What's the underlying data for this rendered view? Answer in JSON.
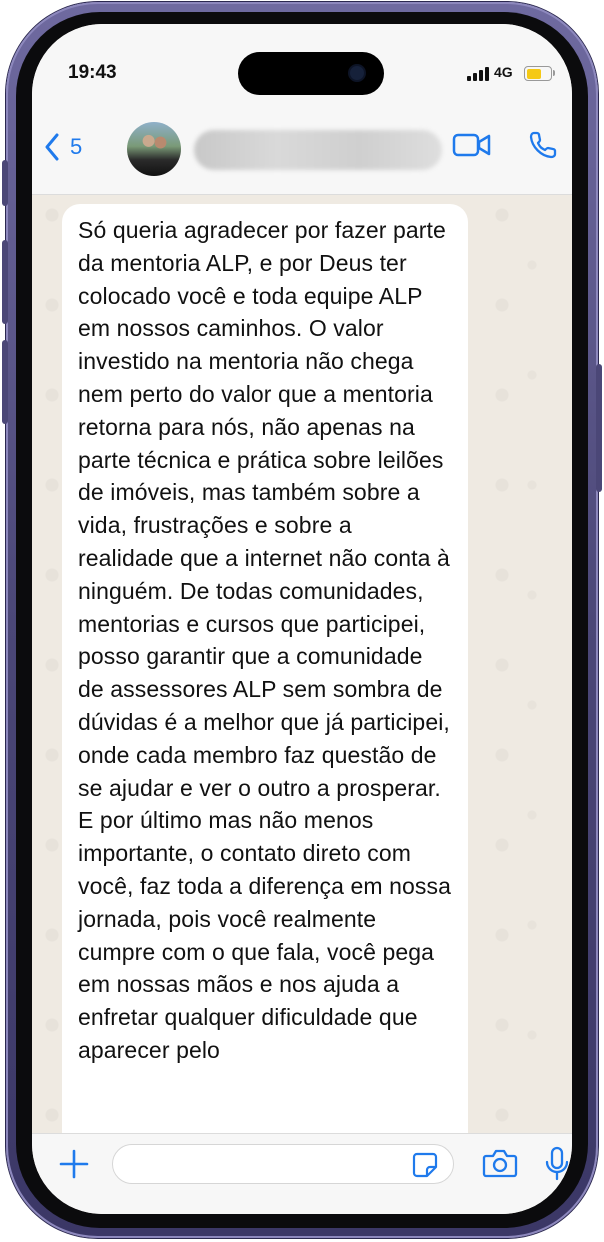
{
  "status_bar": {
    "time": "19:43",
    "network": "4G",
    "battery_level": 0.65
  },
  "header": {
    "back_count": "5",
    "contact_name_blurred": true
  },
  "message": {
    "text": "Só queria agradecer por fazer parte da mentoria ALP, e por Deus ter colocado você e toda equipe ALP em nossos caminhos. O valor investido na mentoria não chega nem perto do valor que a mentoria retorna para nós, não apenas na parte técnica e prática sobre leilões de imóveis, mas também sobre a vida, frustrações e sobre a realidade que a internet não conta à ninguém. De todas comunidades, mentorias e cursos que participei, posso garantir que a comunidade de assessores ALP sem sombra de dúvidas é a melhor que já participei, onde cada membro faz questão de se ajudar e ver o outro a prosperar.\nE por último mas não menos importante, o contato direto com você, faz toda a diferença em nossa jornada, pois você realmente cumpre com o que fala, você pega em nossas mãos e nos ajuda a enfretar qualquer dificuldade que aparecer pelo"
  },
  "input_bar": {
    "value": "",
    "placeholder": ""
  },
  "colors": {
    "accent": "#1f7aec",
    "chat_background": "#efeae2",
    "bubble": "#ffffff",
    "bars": "#f7f7f7",
    "phone_frame": "#4b4777"
  },
  "icons": {
    "back": "chevron-left-icon",
    "video": "video-camera-icon",
    "call": "phone-icon",
    "add": "plus-icon",
    "sticker": "sticker-icon",
    "camera": "camera-icon",
    "mic": "microphone-icon"
  }
}
